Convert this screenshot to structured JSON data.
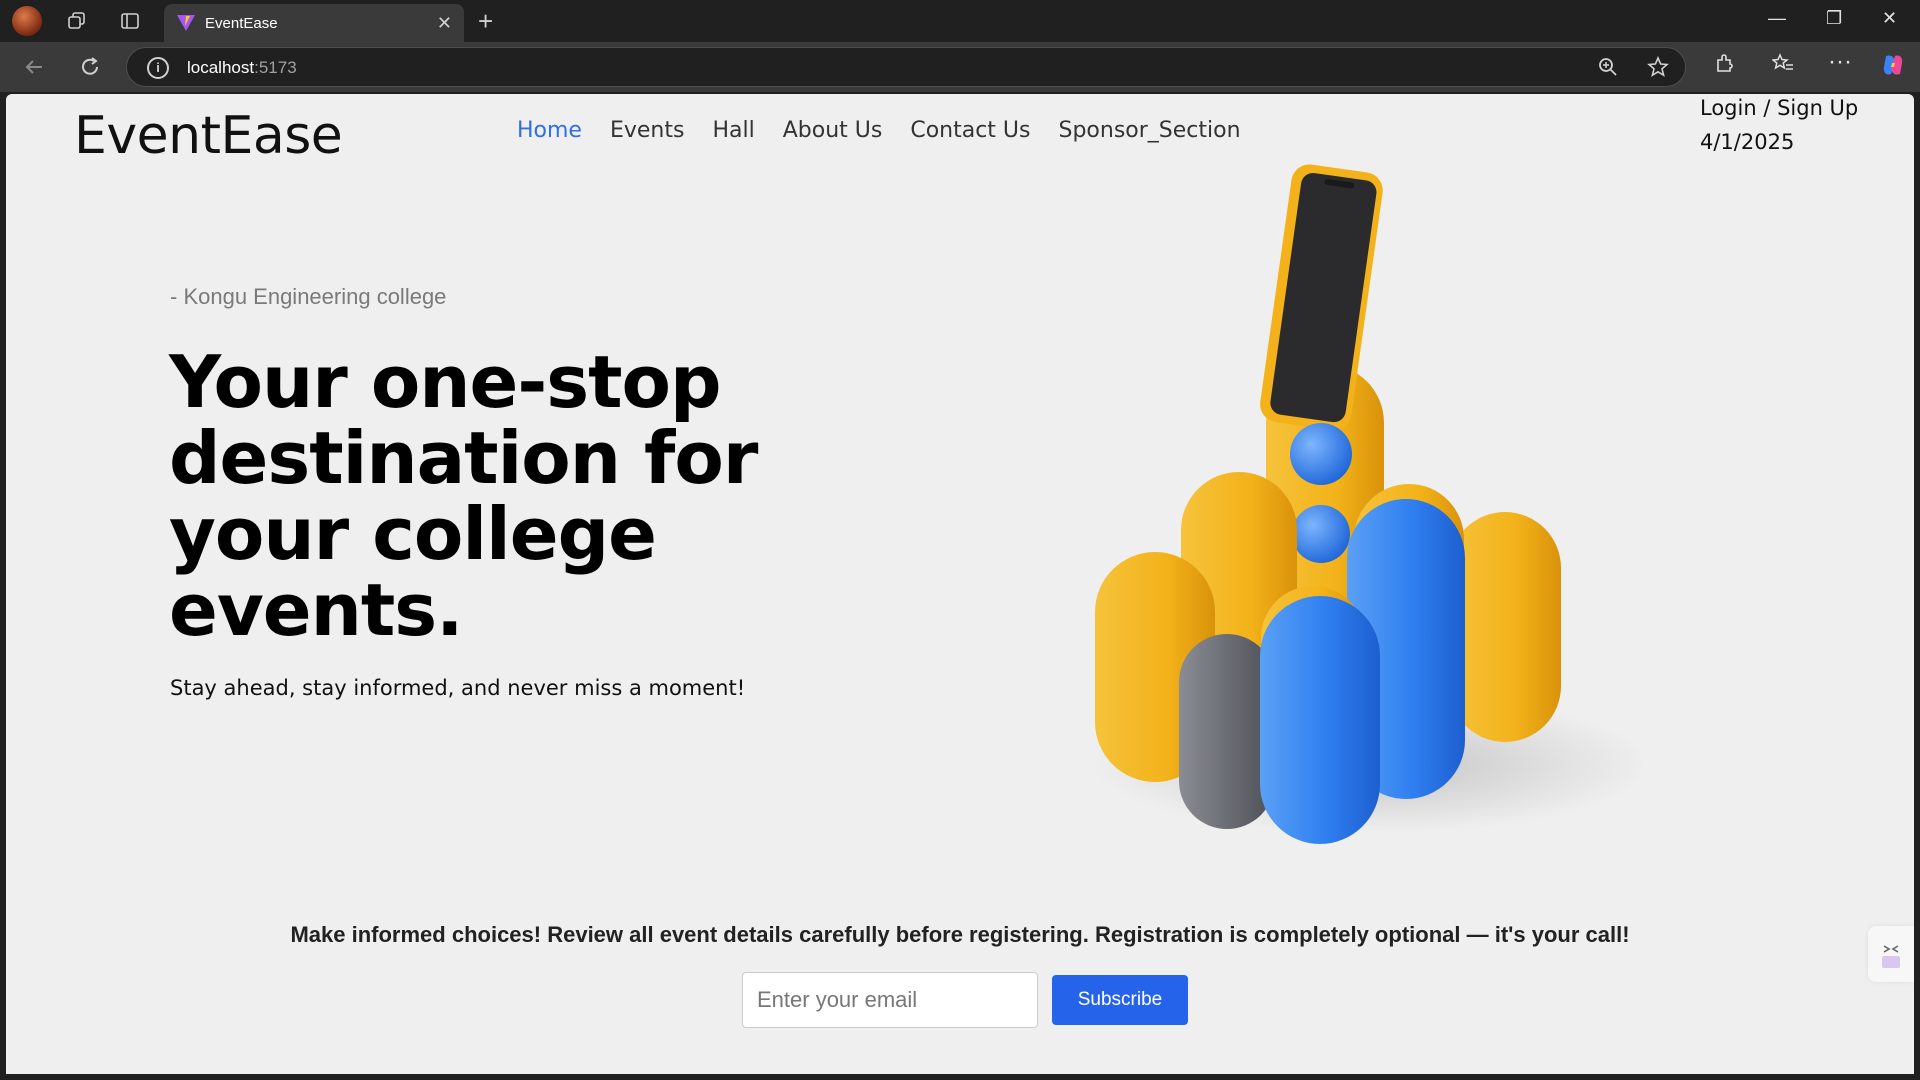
{
  "browser": {
    "tab_title": "EventEase",
    "url_host": "localhost",
    "url_port": ":5173"
  },
  "site": {
    "logo": "EventEase",
    "nav": [
      "Home",
      "Events",
      "Hall",
      "About Us",
      "Contact Us",
      "Sponsor_Section"
    ],
    "active_nav": "Home",
    "auth_link": "Login / Sign Up",
    "date": "4/1/2025"
  },
  "hero": {
    "subtitle": "- Kongu Engineering college",
    "headline": "Your one-stop destination for your college events.",
    "tagline": "Stay ahead, stay informed, and never miss a moment!"
  },
  "newsletter": {
    "notice": "Make informed choices! Review all event details carefully before registering. Registration is completely optional — it's your call!",
    "email_placeholder": "Enter your email",
    "button_label": "Subscribe"
  },
  "colors": {
    "accent": "#2563eb",
    "active_nav": "#2f6fe0",
    "page_bg": "#efefef"
  }
}
